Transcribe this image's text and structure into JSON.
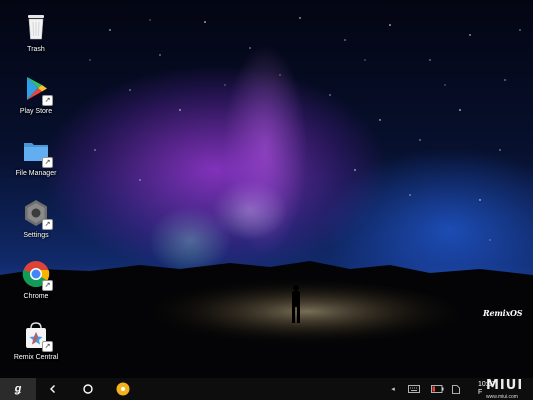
{
  "desktop": {
    "icons": [
      {
        "label": "Trash",
        "icon": "trash-icon"
      },
      {
        "label": "Play Store",
        "icon": "play-store-icon"
      },
      {
        "label": "File Manager",
        "icon": "folder-icon"
      },
      {
        "label": "Settings",
        "icon": "settings-hexagon-icon"
      },
      {
        "label": "Chrome",
        "icon": "chrome-icon"
      },
      {
        "label": "Remix Central",
        "icon": "remix-central-bag-icon"
      }
    ],
    "wallpaper_watermark": "RemixOS"
  },
  "taskbar": {
    "start_label": "ǥ",
    "tray_arrow": "◂",
    "clock_time": "10:07",
    "clock_day": "F"
  },
  "watermark": {
    "text": "MIUI",
    "subtext": "www.miui.com"
  },
  "colors": {
    "taskbar": "#0d0d0d",
    "start_button": "#2b2b2b",
    "app_circle": "#f5b21b"
  }
}
